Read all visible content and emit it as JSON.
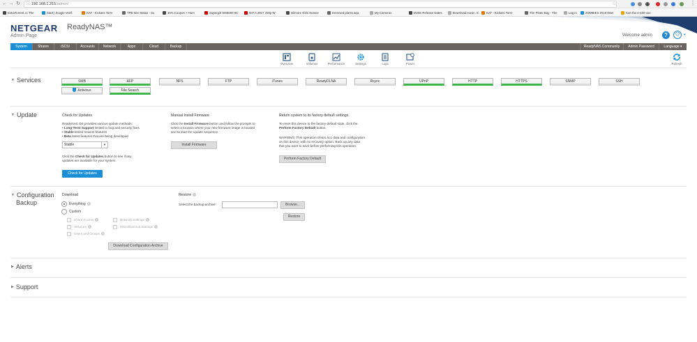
{
  "browser": {
    "url_host": "192.168.1.215",
    "url_path": "/admin/",
    "bookmarks": [
      {
        "label": "ExtraTorrent.cc The",
        "color": "#444"
      },
      {
        "label": "Start | Zoogle Verifi",
        "color": "#1b8fd6"
      },
      {
        "label": "KAT - Kickass Torre",
        "color": "#e07b00"
      },
      {
        "label": "TPB Site Status - Su",
        "color": "#666"
      },
      {
        "label": "15% Coupon + Hum",
        "color": "#444"
      },
      {
        "label": "Supergirl S03E08 HC",
        "color": "#c00"
      },
      {
        "label": "M.F.A 2017 720p W",
        "color": "#c00"
      },
      {
        "label": "Gilmore Girls Seasor",
        "color": "#444"
      },
      {
        "label": "Emersed plants aqu",
        "color": "#666"
      },
      {
        "label": "My Cameras",
        "color": "#aaa"
      },
      {
        "label": "DVDs Release Dates",
        "color": "#444"
      },
      {
        "label": "Download music, m",
        "color": "#aaa"
      },
      {
        "label": "KAT - Kickass Torre",
        "color": "#e07b00"
      },
      {
        "label": "The Pirate Bay - The",
        "color": "#666"
      },
      {
        "label": "Log in",
        "color": "#aaa"
      },
      {
        "label": "ZOMBIES 2018 Dow",
        "color": "#1b8fd6"
      },
      {
        "label": "Can the A-400 use",
        "color": "#e6a800"
      }
    ]
  },
  "header": {
    "brand": "NETGEAR",
    "product": "ReadyNAS™",
    "subtitle": "Admin Page",
    "welcome": "Welcome admin",
    "help": "?",
    "power": "⏻"
  },
  "nav": {
    "tabs": [
      "System",
      "Shares",
      "iSCSI",
      "Accounts",
      "Network",
      "Apps",
      "Cloud",
      "Backup"
    ],
    "right": [
      "ReadyNAS Community",
      "Admin Password",
      "Language ▾"
    ]
  },
  "subnav": {
    "items": [
      "Overview",
      "Volumes",
      "Performance",
      "Settings",
      "Logs",
      "Power"
    ],
    "refresh": "Refresh"
  },
  "services": {
    "title": "Services",
    "items": [
      {
        "label": "SMB",
        "on": true
      },
      {
        "label": "AFP",
        "on": true
      },
      {
        "label": "NFS",
        "on": false
      },
      {
        "label": "FTP",
        "on": false
      },
      {
        "label": "iTunes",
        "on": false
      },
      {
        "label": "ReadyDLNA",
        "on": false
      },
      {
        "label": "Rsync",
        "on": false
      },
      {
        "label": "UPnP",
        "on": true
      },
      {
        "label": "HTTP",
        "on": true
      },
      {
        "label": "HTTPS",
        "on": true
      },
      {
        "label": "SNMP",
        "on": false
      },
      {
        "label": "SSH",
        "on": false
      },
      {
        "label": "Antivirus",
        "on": false
      },
      {
        "label": "File Search",
        "on": true
      }
    ]
  },
  "update": {
    "title": "Update",
    "check_title": "Check for Updates",
    "check_intro": "ReadyNAS OS provides various update methods:",
    "lts_b": "Long-Term Support",
    "lts_t": " limited to bug and security fixes",
    "stable_b": "Stable",
    "stable_t": " tested newest features",
    "beta_b": "Beta",
    "beta_t": " latest features that are being developed",
    "channel": "Stable",
    "click_pre": "Click the ",
    "click_b": "Check for Updates",
    "click_post": " button to see if any",
    "click_line2": "updates are available for your system.",
    "check_btn": "Check for Updates",
    "manual_title": "Manual Install Firmware",
    "manual_pre": "Click the ",
    "manual_b": "Install Firmware",
    "manual_post": " button and follow the prompts to",
    "manual_line2": "select a location where your new firmware image is located",
    "manual_line3": "and to start the update sequence.",
    "install_btn": "Install Firmware",
    "factory_title": "Return system to its factory default settings.",
    "factory_line1": "To reset this device to the factory default state, click the",
    "factory_b": "Perform Factory Default",
    "factory_post": " button.",
    "warn1": "WARNING: This operation clears ALL data and configuration",
    "warn2": "on this device, with no recovery option. Back up any data",
    "warn3": "that you want to save before performing this operation.",
    "factory_btn": "Perform Factory Default"
  },
  "config": {
    "title1": "Configuration",
    "title2": "Backup",
    "download": "Download",
    "everything": "Everything",
    "custom": "Custom",
    "share_access": "Share Access",
    "services": "Services",
    "users_groups": "Users and Groups",
    "network_settings": "Network Settings",
    "misc_settings": "Miscellaneous Settings",
    "download_btn": "Download Configuration Archive",
    "restore": "Restore",
    "select_label": "Select the backup archive:",
    "browse_btn": "Browse...",
    "restore_btn": "Restore",
    "q": "?"
  },
  "alerts": {
    "title": "Alerts"
  },
  "support": {
    "title": "Support"
  },
  "colors": {
    "accent": "#1b8fd6",
    "nav_bg": "#6b6360",
    "green": "#3fb44b"
  }
}
